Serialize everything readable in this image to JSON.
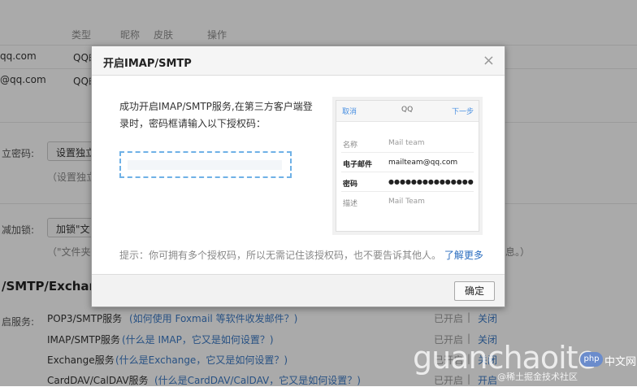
{
  "background": {
    "header": {
      "type": "类型",
      "nickname": "昵称",
      "skin": "皮肤",
      "ops": "操作"
    },
    "accounts": [
      {
        "email": "qq.com",
        "type": "QQ邮"
      },
      {
        "email": "@qq.com",
        "type": "QQ邮"
      }
    ],
    "independent_password": {
      "label": "立密码:",
      "button": "设置独立",
      "hint": "（设置独立"
    },
    "encryption": {
      "label": "减加锁:",
      "button": "加锁\"文",
      "hint": "（\"文件夹",
      "hint_end": "息。）"
    },
    "section_title": "/SMTP/Exchan",
    "services_label": "启服务:",
    "services": [
      {
        "name": "POP3/SMTP服务",
        "help": "(如何使用 Foxmail 等软件收发邮件？)",
        "status": "已开启",
        "sep": "|",
        "action": "关闭"
      },
      {
        "name": "IMAP/SMTP服务",
        "help": "(什么是 IMAP，它又是如何设置？)",
        "status": "已开启",
        "sep": "|",
        "action": "关闭"
      },
      {
        "name": "Exchange服务",
        "help": "(什么是Exchange，它又是如何设置？)",
        "status": "已开启",
        "sep": "|",
        "action": "关闭"
      },
      {
        "name": "CardDAV/CalDAV服务",
        "help": "(什么是CardDAV/CalDAV，它又是如何设置？)",
        "status": "已开启",
        "sep": "|",
        "action": "开启"
      }
    ]
  },
  "dialog": {
    "title": "开启IMAP/SMTP",
    "close": "×",
    "message": "成功开启IMAP/SMTP服务,在第三方客户端登录时，密码框请输入以下授权码：",
    "tip_prefix": "提示：你可拥有多个授权码，所以无需记住该授权码，也不要告诉其他人。",
    "tip_link": "了解更多",
    "ok_button": "确定",
    "phone": {
      "cancel": "取消",
      "title": "QQ",
      "next": "下一步",
      "rows": [
        {
          "label": "名称",
          "value": "Mail team"
        },
        {
          "label": "电子邮件",
          "value": "mailteam@qq.com"
        },
        {
          "label": "密码",
          "value": "●●●●●●●●●●●●●●●"
        },
        {
          "label": "描述",
          "value": "Mail Team"
        }
      ]
    }
  },
  "watermark": {
    "text": "guanchaoite",
    "badge": "php",
    "side": "中文网",
    "sub": "@稀土掘金技术社区"
  }
}
